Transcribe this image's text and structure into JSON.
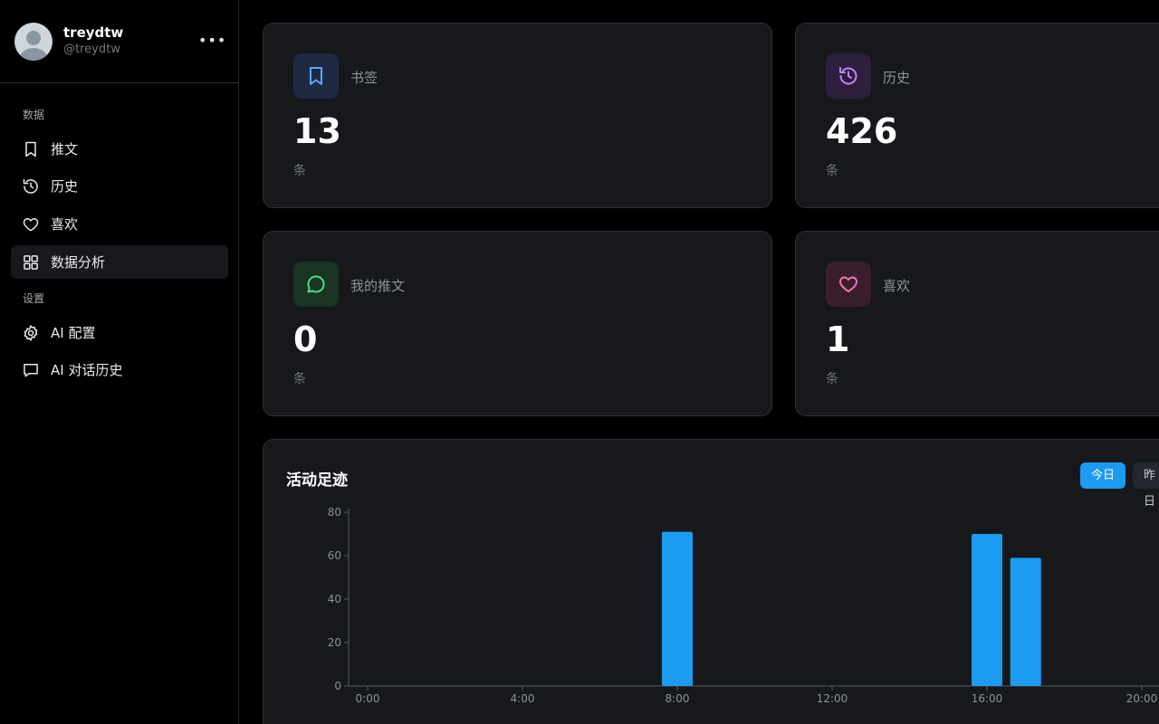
{
  "profile": {
    "name": "treydtw",
    "handle": "@treydtw",
    "more": "•••"
  },
  "sidebar": {
    "section_data": "数据",
    "section_settings": "设置",
    "items": [
      {
        "label": "推文",
        "icon": "bookmark-icon"
      },
      {
        "label": "历史",
        "icon": "history-icon"
      },
      {
        "label": "喜欢",
        "icon": "heart-icon"
      },
      {
        "label": "数据分析",
        "icon": "dashboard-icon",
        "active": true
      },
      {
        "label": "AI 配置",
        "icon": "gear-icon"
      },
      {
        "label": "AI 对话历史",
        "icon": "chat-icon"
      }
    ]
  },
  "stats": [
    {
      "title": "书签",
      "value": "13",
      "unit": "条",
      "icon": "bookmark-icon",
      "color": "#60a5fa",
      "bg": "#1e2a44"
    },
    {
      "title": "历史",
      "value": "426",
      "unit": "条",
      "icon": "history-icon",
      "color": "#c084fc",
      "bg": "#2d1f3d"
    },
    {
      "title": "我的推文",
      "value": "0",
      "unit": "条",
      "icon": "chat-icon",
      "color": "#4ade80",
      "bg": "#1a3322"
    },
    {
      "title": "喜欢",
      "value": "1",
      "unit": "条",
      "icon": "heart-icon",
      "color": "#f472b6",
      "bg": "#3a1e2c"
    }
  ],
  "activity": {
    "title": "活动足迹",
    "tabs": [
      "今日",
      "昨日"
    ],
    "active_tab": "今日"
  },
  "chart_data": {
    "type": "bar",
    "categories": [
      "0:00",
      "1:00",
      "2:00",
      "3:00",
      "4:00",
      "5:00",
      "6:00",
      "7:00",
      "8:00",
      "9:00",
      "10:00",
      "11:00",
      "12:00",
      "13:00",
      "14:00",
      "15:00",
      "16:00",
      "17:00",
      "18:00",
      "19:00",
      "20:00"
    ],
    "values": [
      0,
      0,
      0,
      0,
      0,
      0,
      0,
      0,
      71,
      0,
      0,
      0,
      0,
      0,
      0,
      0,
      70,
      59,
      0,
      0,
      0
    ],
    "xticks": [
      "0:00",
      "4:00",
      "8:00",
      "12:00",
      "16:00",
      "20:00"
    ],
    "yticks": [
      0,
      20,
      40,
      60,
      80
    ],
    "ylim": [
      0,
      80
    ],
    "bar_color": "#1d9bf0"
  }
}
